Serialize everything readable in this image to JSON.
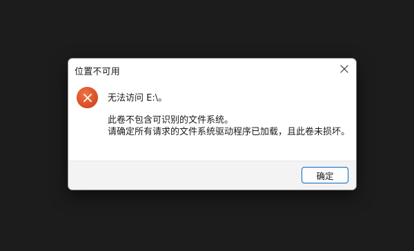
{
  "dialog": {
    "title": "位置不可用",
    "message_main": "无法访问 E:\\。",
    "message_detail_line1": "此卷不包含可识别的文件系统。",
    "message_detail_line2": "请确定所有请求的文件系统驱动程序已加载，且此卷未损坏。",
    "ok_label": "确定",
    "icons": {
      "status": "error-icon",
      "close": "close-icon"
    }
  },
  "colors": {
    "desktop_background": "#1c1c1c",
    "error_icon": "#d54a22",
    "button_accent": "#0067c0"
  }
}
